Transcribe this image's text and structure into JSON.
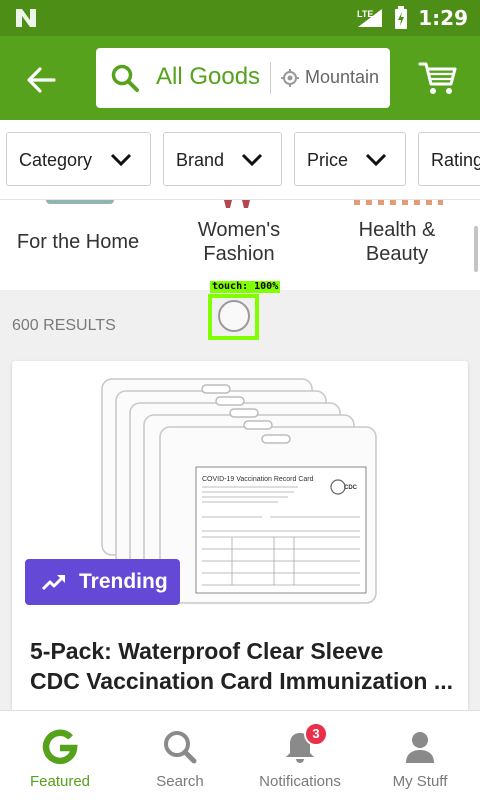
{
  "status_bar": {
    "network": "LTE",
    "time": "1:29"
  },
  "app_bar": {
    "search_query": "All Goods",
    "location": "Mountain",
    "icons": [
      "back-arrow-icon",
      "search-icon",
      "location-pin-icon",
      "cart-icon"
    ]
  },
  "filters": [
    {
      "label": "Category"
    },
    {
      "label": "Brand"
    },
    {
      "label": "Price"
    },
    {
      "label": "Rating"
    }
  ],
  "categories": [
    {
      "label": "For the Home"
    },
    {
      "label": "Women's Fashion"
    },
    {
      "label": "Health & Beauty"
    }
  ],
  "touch_overlay": {
    "label": "touch: 100%"
  },
  "results": {
    "count_text": "600 RESULTS"
  },
  "product": {
    "badge": "Trending",
    "title_line1": "5-Pack: Waterproof Clear Sleeve",
    "title_line2": "CDC Vaccination Card Immunization ...",
    "image_card_title": "COVID-19 Vaccination Record Card",
    "image_logo": "CDC"
  },
  "bottom_nav": {
    "items": [
      {
        "label": "Featured",
        "icon": "featured-g-icon",
        "active": true
      },
      {
        "label": "Search",
        "icon": "search-icon"
      },
      {
        "label": "Notifications",
        "icon": "bell-icon",
        "badge": "3"
      },
      {
        "label": "My Stuff",
        "icon": "person-icon"
      }
    ]
  },
  "colors": {
    "brand_green": "#56a21c",
    "status_green": "#4d8e17",
    "trending_purple": "#6349d6",
    "badge_red": "#e8304a",
    "touch_green": "#7fff00"
  }
}
